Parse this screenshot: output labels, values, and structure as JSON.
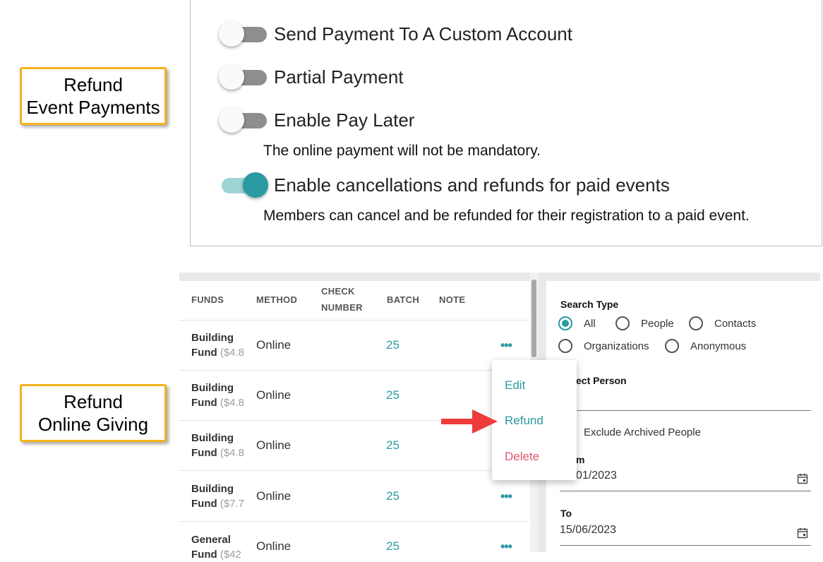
{
  "callouts": {
    "event_refund": [
      "Refund",
      "Event Payments"
    ],
    "online_refund": [
      "Refund",
      "Online Giving"
    ]
  },
  "settings": [
    {
      "label": "Send Payment To A Custom Account",
      "on": false,
      "description": ""
    },
    {
      "label": "Partial Payment",
      "on": false,
      "description": ""
    },
    {
      "label": "Enable Pay Later",
      "on": false,
      "description": "The online payment will not be mandatory."
    },
    {
      "label": "Enable cancellations and refunds for paid events",
      "on": true,
      "description": "Members can cancel and be refunded for their registration to a paid event."
    }
  ],
  "table": {
    "headers": {
      "funds": "FUNDS",
      "method": "METHOD",
      "check_1": "CHECK",
      "check_2": "NUMBER",
      "batch": "BATCH",
      "note": "NOTE"
    },
    "rows": [
      {
        "fund_1": "Building",
        "fund_2": "Fund",
        "amount": "($4.8",
        "method": "Online",
        "batch": "25",
        "more": "•••"
      },
      {
        "fund_1": "Building",
        "fund_2": "Fund",
        "amount": "($4.8",
        "method": "Online",
        "batch": "25",
        "more": ""
      },
      {
        "fund_1": "Building",
        "fund_2": "Fund",
        "amount": "($4.8",
        "method": "Online",
        "batch": "25",
        "more": ""
      },
      {
        "fund_1": "Building",
        "fund_2": "Fund",
        "amount": "($7.7",
        "method": "Online",
        "batch": "25",
        "more": "•••"
      },
      {
        "fund_1": "General",
        "fund_2": "Fund",
        "amount": "($42",
        "method": "Online",
        "batch": "25",
        "more": "•••"
      }
    ]
  },
  "menu": {
    "edit": "Edit",
    "refund": "Refund",
    "delete": "Delete"
  },
  "search": {
    "search_type_label": "Search Type",
    "options": {
      "all": "All",
      "people": "People",
      "contacts": "Contacts",
      "organizations": "Organizations",
      "anonymous": "Anonymous"
    },
    "selected": "all",
    "select_person_label": "ect Person",
    "exclude_archived": "Exclude Archived People",
    "from_label": "m",
    "from_value": "01/2023",
    "to_label": "To",
    "to_value": "15/06/2023"
  },
  "colors": {
    "accent": "#2a9aa3",
    "delete": "#e0566e",
    "arrow": "#ef3b3b",
    "callout_border": "#f5b21b"
  }
}
